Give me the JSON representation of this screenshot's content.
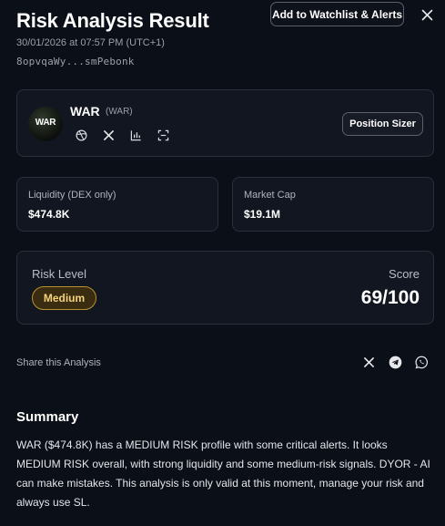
{
  "header": {
    "title": "Risk Analysis Result",
    "watchlist_button": "Add to Watchlist & Alerts",
    "timestamp": "30/01/2026 at 07:57 PM (UTC+1)",
    "address": "8opvqaWy...smPebonk"
  },
  "token": {
    "logo_text": "WAR",
    "name": "WAR",
    "symbol": "(WAR)",
    "icons": [
      "website-icon",
      "x-icon",
      "chart-icon",
      "scan-icon"
    ],
    "position_sizer_button": "Position Sizer"
  },
  "stats": {
    "liquidity_label": "Liquidity (DEX only)",
    "liquidity_value": "$474.8K",
    "market_cap_label": "Market Cap",
    "market_cap_value": "$19.1M"
  },
  "risk": {
    "level_label": "Risk Level",
    "level_value": "Medium",
    "score_label": "Score",
    "score_value": "69/100",
    "badge_color": "#b8902e"
  },
  "share": {
    "label": "Share this Analysis",
    "icons": [
      "x-icon",
      "telegram-icon",
      "whatsapp-icon"
    ]
  },
  "summary": {
    "title": "Summary",
    "text": "WAR ($474.8K) has a MEDIUM RISK profile with some critical alerts. It looks MEDIUM RISK overall, with strong liquidity and some medium-risk signals. DYOR - AI can make mistakes. This analysis is only valid at this moment, manage your risk and always use SL."
  }
}
